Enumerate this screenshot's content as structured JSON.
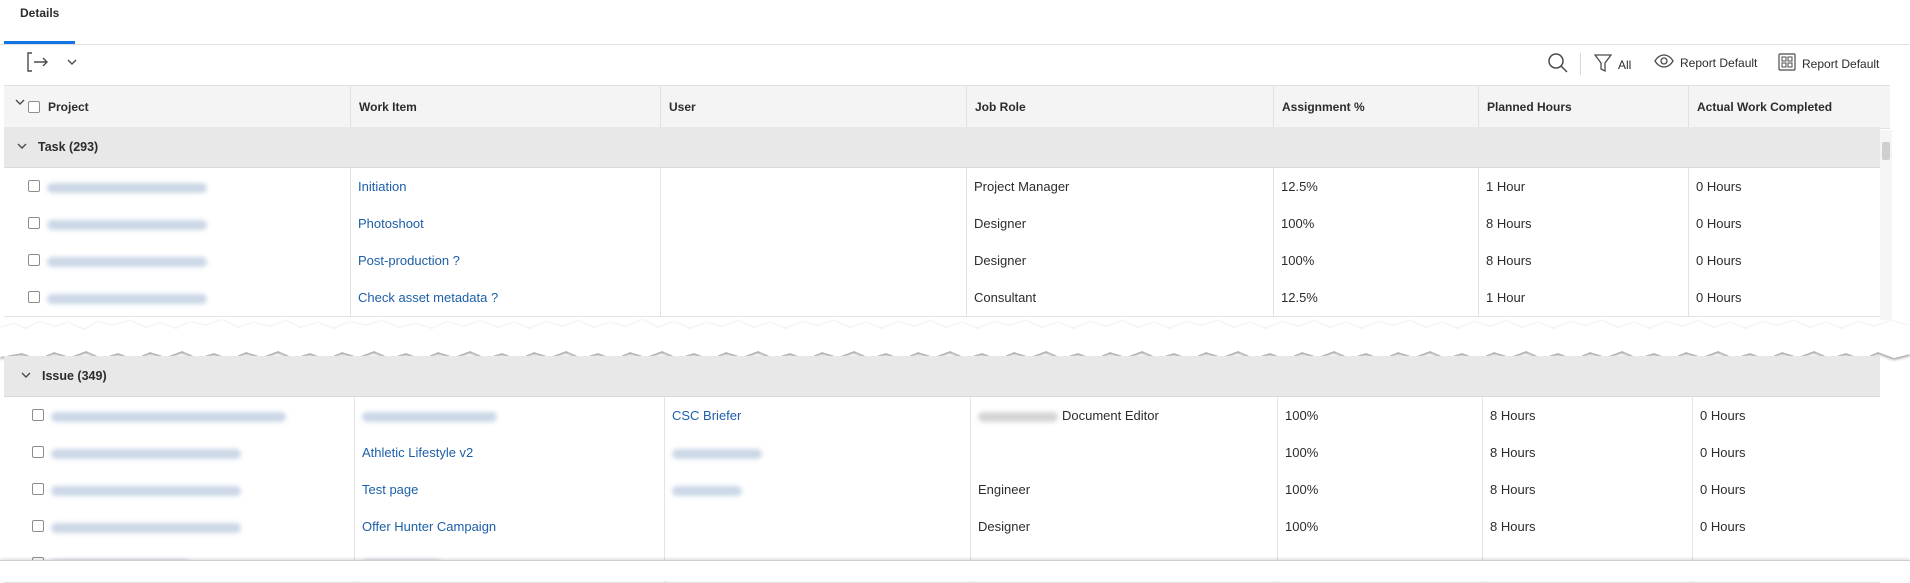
{
  "tabs": [
    {
      "label": "Details"
    }
  ],
  "toolbar": {
    "filter_label": "All",
    "view_label": "Report Default",
    "grouping_label": "Report Default"
  },
  "columns": [
    "Project",
    "Work Item",
    "User",
    "Job Role",
    "Assignment %",
    "Planned Hours",
    "Actual Work Completed"
  ],
  "groups": [
    {
      "label": "Task (293)",
      "rows": [
        {
          "work_item": "Initiation",
          "job_role": "Project Manager",
          "assignment": "12.5%",
          "planned": "1 Hour",
          "actual": "0 Hours"
        },
        {
          "work_item": "Photoshoot",
          "job_role": "Designer",
          "assignment": "100%",
          "planned": "8 Hours",
          "actual": "0 Hours"
        },
        {
          "work_item": "Post-production ?",
          "job_role": "Designer",
          "assignment": "100%",
          "planned": "8 Hours",
          "actual": "0 Hours"
        },
        {
          "work_item": "Check asset metadata ?",
          "job_role": "Consultant",
          "assignment": "12.5%",
          "planned": "1 Hour",
          "actual": "0 Hours"
        }
      ]
    },
    {
      "label": "Issue (349)",
      "rows": [
        {
          "work_item": "",
          "user": "CSC Briefer",
          "job_role": "Document Editor",
          "assignment": "100%",
          "planned": "8 Hours",
          "actual": "0 Hours"
        },
        {
          "work_item": "Athletic Lifestyle v2",
          "user": "",
          "job_role": "",
          "assignment": "100%",
          "planned": "8 Hours",
          "actual": "0 Hours"
        },
        {
          "work_item": "Test page",
          "user": "",
          "job_role": "Engineer",
          "assignment": "100%",
          "planned": "8 Hours",
          "actual": "0 Hours"
        },
        {
          "work_item": "Offer Hunter Campaign",
          "user": "",
          "job_role": "Designer",
          "assignment": "100%",
          "planned": "8 Hours",
          "actual": "0 Hours"
        }
      ]
    }
  ],
  "colors": {
    "accent": "#1473e6",
    "link": "#1d5fa8",
    "header_bg": "#f4f4f4",
    "group_bg": "#e8e8e8"
  },
  "icons": [
    "export-icon",
    "chevron-down-icon",
    "search-icon",
    "filter-icon",
    "eye-icon",
    "grid-icon"
  ]
}
